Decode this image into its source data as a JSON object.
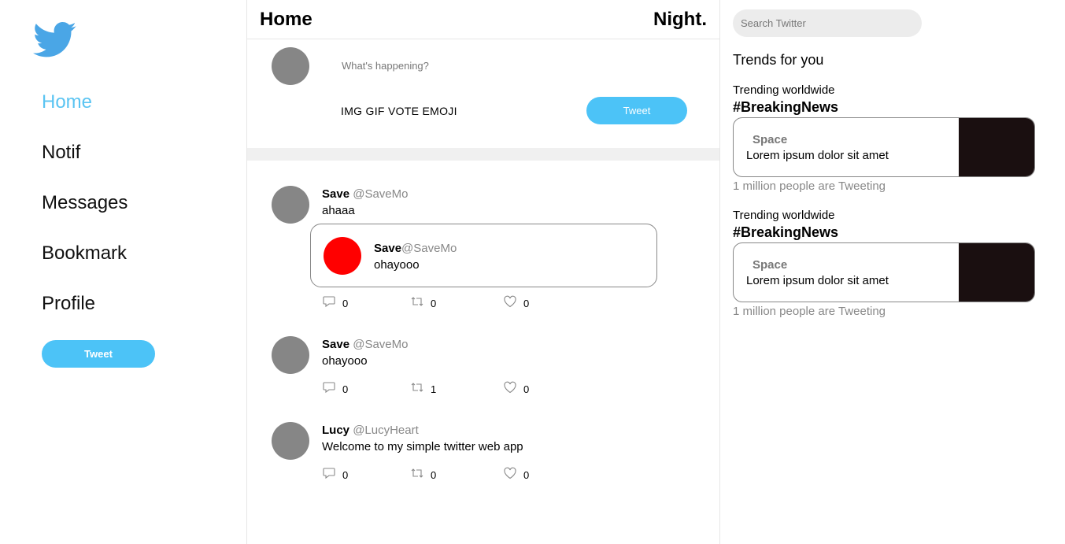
{
  "sidebar": {
    "logo_icon": "twitter-bird-icon",
    "nav": [
      {
        "label": "Home",
        "active": true
      },
      {
        "label": "Notif"
      },
      {
        "label": "Messages"
      },
      {
        "label": "Bookmark"
      },
      {
        "label": "Profile"
      }
    ],
    "tweet_button": "Tweet"
  },
  "header": {
    "title": "Home",
    "night_label": "Night."
  },
  "composer": {
    "placeholder": "What's happening?",
    "tools": [
      "IMG",
      "GIF",
      "VOTE",
      "EMOJI"
    ],
    "tweet_button": "Tweet"
  },
  "tweets": [
    {
      "name": "Save",
      "handle": "@SaveMo",
      "text": "ahaaa",
      "quote": {
        "name": "Save",
        "handle": "@SaveMo",
        "text": "ohayooo"
      },
      "replies": "0",
      "retweets": "0",
      "likes": "0"
    },
    {
      "name": "Save",
      "handle": "@SaveMo",
      "text": "ohayooo",
      "replies": "0",
      "retweets": "1",
      "likes": "0"
    },
    {
      "name": "Lucy",
      "handle": "@LucyHeart",
      "text": "Welcome to my simple twitter web app",
      "replies": "0",
      "retweets": "0",
      "likes": "0"
    }
  ],
  "right": {
    "search_placeholder": "Search Twitter",
    "trends_title": "Trends for you",
    "trends": [
      {
        "label": "Trending worldwide",
        "tag": "#BreakingNews",
        "card_title": "Space",
        "card_body": "Lorem ipsum dolor sit amet",
        "count": "1 million people are Tweeting"
      },
      {
        "label": "Trending worldwide",
        "tag": "#BreakingNews",
        "card_title": "Space",
        "card_body": "Lorem ipsum dolor sit amet",
        "count": "1 million people are Tweeting"
      }
    ]
  },
  "colors": {
    "accent": "#4cc3f7",
    "nav_active": "#5ac4f2",
    "avatar_gray": "#868686",
    "quote_avatar": "#ff0000",
    "trend_image": "#1a0f10"
  }
}
